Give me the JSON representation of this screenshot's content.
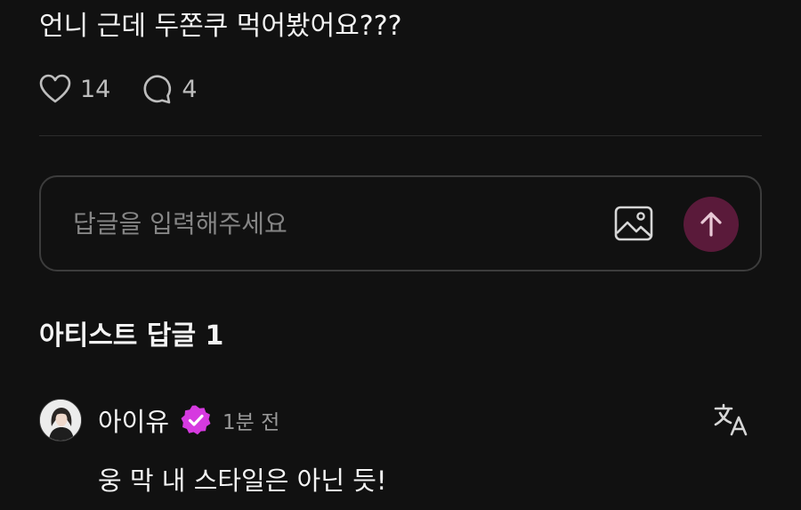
{
  "post": {
    "text": "언니 근데 두쫀쿠 먹어봤어요???",
    "likes": "14",
    "comments": "4"
  },
  "reply": {
    "placeholder": "답글을 입력해주세요",
    "image_icon": "image-icon",
    "send_icon": "arrow-up-icon",
    "send_color": "#5a1a3a"
  },
  "artist_replies": {
    "title": "아티스트 답글 1",
    "items": [
      {
        "author": "아이유",
        "verified_color": "#d63ae0",
        "time": "1분 전",
        "text": "웅 막 내 스타일은 아닌 듯!",
        "translate_icon": "translate-icon"
      }
    ]
  }
}
